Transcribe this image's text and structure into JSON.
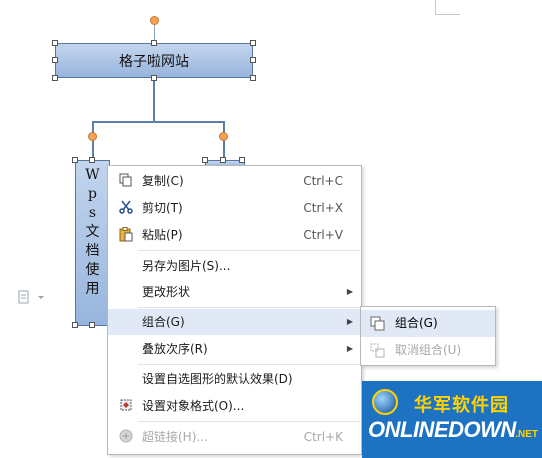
{
  "diagram": {
    "top_node": "格子啦网站",
    "left_node_chars": [
      "W",
      "p",
      "s",
      "文",
      "档",
      "使",
      "用"
    ]
  },
  "context_menu": {
    "items": [
      {
        "label": "复制(C)",
        "shortcut": "Ctrl+C",
        "icon": "copy-icon"
      },
      {
        "label": "剪切(T)",
        "shortcut": "Ctrl+X",
        "icon": "scissors-icon"
      },
      {
        "label": "粘贴(P)",
        "shortcut": "Ctrl+V",
        "icon": "paste-icon"
      },
      {
        "label": "另存为图片(S)..."
      },
      {
        "label": "更改形状",
        "submenu": true
      },
      {
        "label": "组合(G)",
        "submenu": true,
        "highlighted": true
      },
      {
        "label": "叠放次序(R)",
        "submenu": true
      },
      {
        "label": "设置自选图形的默认效果(D)"
      },
      {
        "label": "设置对象格式(O)...",
        "icon": "format-object-icon"
      },
      {
        "label": "超链接(H)...",
        "shortcut": "Ctrl+K",
        "icon": "hyperlink-icon",
        "disabled": true
      }
    ]
  },
  "submenu": {
    "items": [
      {
        "label": "组合(G)",
        "icon": "group-icon",
        "highlighted": true
      },
      {
        "label": "取消组合(U)",
        "icon": "ungroup-icon",
        "disabled": true
      }
    ]
  },
  "watermark": {
    "cn": "华军软件园",
    "en": "ONLINEDOWN",
    "suffix": ".NET"
  },
  "colors": {
    "shape_fill": "#a9c3e6",
    "connector": "#5b7fa6",
    "menu_highlight": "#e1e9f7",
    "watermark_bg": "#1d73c2"
  }
}
